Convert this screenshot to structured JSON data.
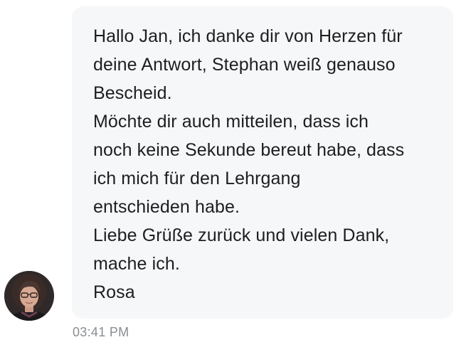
{
  "message": {
    "lines": [
      "Hallo Jan, ich danke dir von Herzen für",
      "deine Antwort, Stephan weiß genauso",
      "Bescheid.",
      "Möchte dir auch mitteilen, dass ich",
      "noch keine Sekunde bereut habe, dass",
      "ich mich für den Lehrgang",
      "entschieden habe.",
      "Liebe Grüße zurück und vielen Dank,",
      "mache ich.",
      "Rosa"
    ],
    "timestamp": "03:41 PM"
  },
  "sender": {
    "avatar_icon": "user-avatar-photo"
  },
  "colors": {
    "bubble_background": "#f6f7f9",
    "message_text": "#1c1e21",
    "timestamp_text": "#8a8d91"
  }
}
